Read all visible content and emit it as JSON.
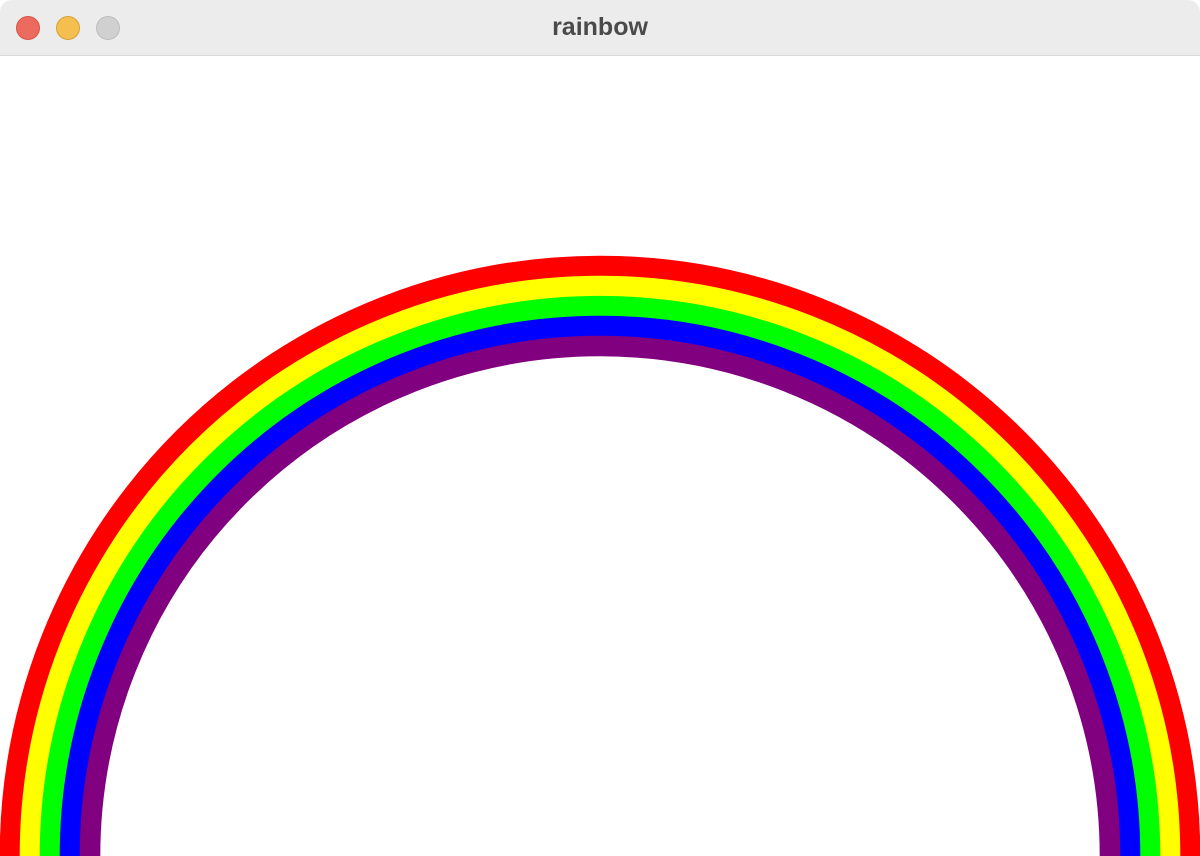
{
  "window": {
    "title": "rainbow",
    "controls": {
      "close_color": "#ec6a5e",
      "minimize_color": "#f4bf4f",
      "zoom_color": "#d0d0d0"
    }
  },
  "rainbow": {
    "bands": [
      {
        "name": "red",
        "color": "#ff0000"
      },
      {
        "name": "yellow",
        "color": "#ffff00"
      },
      {
        "name": "green",
        "color": "#00ff00"
      },
      {
        "name": "blue",
        "color": "#0000ff"
      },
      {
        "name": "purple",
        "color": "#800080"
      }
    ],
    "background_color": "#ffffff"
  }
}
